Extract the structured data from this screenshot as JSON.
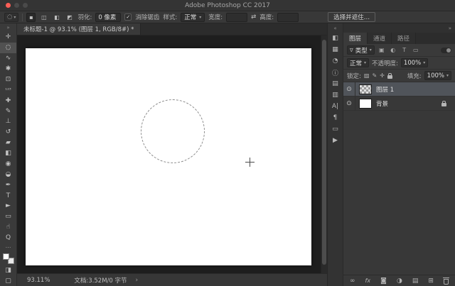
{
  "ui": {
    "dropdown_arrow": "▾",
    "chevron_right": "›",
    "dock_chevron": "»",
    "dock_chevron_left": "«",
    "check": "✓"
  },
  "title_bar": {
    "title": "Adobe Photoshop CC 2017"
  },
  "options_bar": {
    "tool_preset_icon": "◌",
    "mode_new_icon": "▪",
    "mode_add_icon": "◫",
    "mode_subtract_icon": "◧",
    "mode_intersect_icon": "◩",
    "feather_label": "羽化:",
    "feather_value": "0 像素",
    "antialias_label": "消除锯齿",
    "style_label": "样式:",
    "style_value": "正常",
    "width_label": "宽度:",
    "width_value": "",
    "swap_icon": "⇄",
    "height_label": "高度:",
    "height_value": "",
    "select_mask_button": "选择并遮住…"
  },
  "document": {
    "tab_title": "未标题-1 @ 93.1% (图层 1, RGB/8#) *"
  },
  "toolbar": {
    "collapse_icon": "»",
    "tools": [
      {
        "name": "move-tool",
        "glyph": "✛"
      },
      {
        "name": "elliptical-marquee-tool",
        "glyph": "◌"
      },
      {
        "name": "lasso-tool",
        "glyph": "∿"
      },
      {
        "name": "quick-selection-tool",
        "glyph": "✱"
      },
      {
        "name": "crop-tool",
        "glyph": "⊡"
      },
      {
        "name": "count-tool",
        "glyph": "¹²³"
      },
      {
        "name": "healing-brush-tool",
        "glyph": "✚"
      },
      {
        "name": "brush-tool",
        "glyph": "✎"
      },
      {
        "name": "clone-stamp-tool",
        "glyph": "⊥"
      },
      {
        "name": "history-brush-tool",
        "glyph": "↺"
      },
      {
        "name": "eraser-tool",
        "glyph": "▰"
      },
      {
        "name": "gradient-tool",
        "glyph": "◧"
      },
      {
        "name": "blur-tool",
        "glyph": "◉"
      },
      {
        "name": "dodge-tool",
        "glyph": "◒"
      },
      {
        "name": "pen-tool",
        "glyph": "✒"
      },
      {
        "name": "type-tool",
        "glyph": "T"
      },
      {
        "name": "path-selection-tool",
        "glyph": "►"
      },
      {
        "name": "shape-tool",
        "glyph": "▭"
      },
      {
        "name": "hand-tool",
        "glyph": "☝"
      },
      {
        "name": "zoom-tool",
        "glyph": "Q"
      }
    ],
    "more_icon": "⋯",
    "quick_mask_icon": "◨",
    "screen_mode_icon": "▢"
  },
  "panel_strip": {
    "icons": [
      {
        "name": "color-panel-icon",
        "glyph": "◧"
      },
      {
        "name": "swatches-panel-icon",
        "glyph": "▦"
      },
      {
        "name": "adjustments-panel-icon",
        "glyph": "◔"
      },
      {
        "name": "info-panel-icon",
        "glyph": "ⓘ"
      },
      {
        "name": "libraries-panel-icon",
        "glyph": "▤"
      },
      {
        "name": "histogram-panel-icon",
        "glyph": "▥"
      },
      {
        "name": "character-panel-icon",
        "glyph": "A|"
      },
      {
        "name": "paragraph-panel-icon",
        "glyph": "¶"
      },
      {
        "name": "timeline-panel-icon",
        "glyph": "▭"
      },
      {
        "name": "actions-panel-icon",
        "glyph": "▶"
      }
    ]
  },
  "layers_panel": {
    "tabs": [
      {
        "label": "图层"
      },
      {
        "label": "通道"
      },
      {
        "label": "路径"
      }
    ],
    "filter": {
      "funnel_icon": "∇",
      "kind_label": "类型",
      "pixel_filter_icon": "▣",
      "adjustment_filter_icon": "◐",
      "type_filter_icon": "T",
      "shape_filter_icon": "▭"
    },
    "blend_mode": "正常",
    "opacity_label": "不透明度:",
    "opacity_value": "100%",
    "lock_label": "锁定:",
    "lock_transparency_icon": "▨",
    "lock_pixels_icon": "✎",
    "lock_position_icon": "✛",
    "fill_label": "填充:",
    "fill_value": "100%",
    "eye_icon": "⊙",
    "layers": [
      {
        "name": "图层 1",
        "selected": true,
        "visible": true,
        "thumb": "checker"
      },
      {
        "name": "背景",
        "selected": false,
        "visible": true,
        "thumb": "white",
        "locked": true
      }
    ],
    "bottom": {
      "link_icon": "∞",
      "fx_icon": "fx",
      "mask_icon": "◙",
      "adjust_icon": "◑",
      "group_icon": "▤",
      "new_layer_icon": "⊞"
    }
  },
  "status_bar": {
    "zoom": "93.11%",
    "doc_info": "文档:3.52M/0 字节"
  }
}
